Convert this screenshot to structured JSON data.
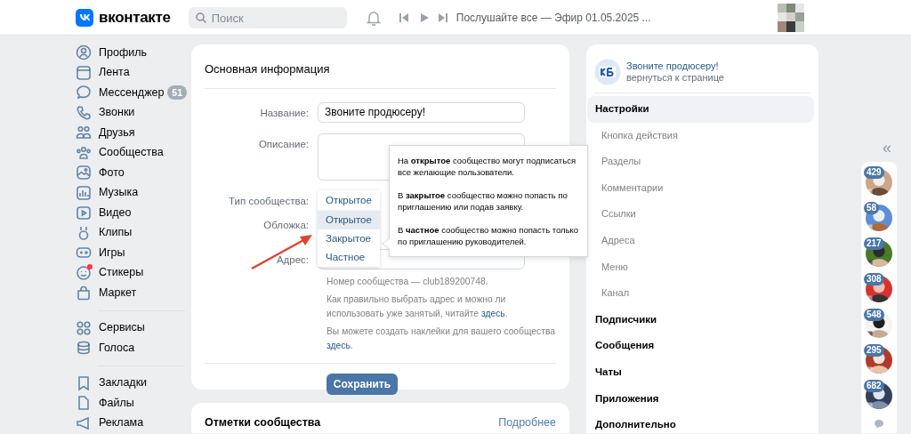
{
  "header": {
    "logo": "вконтакте",
    "search": {
      "placeholder": "Поиск"
    },
    "player_text": "Послушайте все — Эфир 01.05.2025 ..."
  },
  "nav": {
    "groups": [
      [
        {
          "label": "Профиль"
        },
        {
          "label": "Лента"
        },
        {
          "label": "Мессенджер",
          "badge": "51"
        },
        {
          "label": "Звонки"
        },
        {
          "label": "Друзья"
        },
        {
          "label": "Сообщества"
        },
        {
          "label": "Фото"
        },
        {
          "label": "Музыка"
        },
        {
          "label": "Видео"
        },
        {
          "label": "Клипы"
        },
        {
          "label": "Игры"
        },
        {
          "label": "Стикеры",
          "dot": true
        },
        {
          "label": "Маркет"
        }
      ],
      [
        {
          "label": "Сервисы"
        },
        {
          "label": "Голоса"
        }
      ],
      [
        {
          "label": "Закладки"
        },
        {
          "label": "Файлы"
        },
        {
          "label": "Реклама"
        }
      ]
    ]
  },
  "main_card": {
    "title": "Основная информация",
    "fields": [
      {
        "kind": "input",
        "label": "Название:",
        "value": "Звоните продюсеру!"
      },
      {
        "kind": "textarea",
        "label": "Описание:"
      },
      {
        "kind": "select",
        "label": "Тип сообщества:",
        "value": "Открытое"
      },
      {
        "kind": "cover",
        "label": "Обложка:"
      },
      {
        "kind": "input",
        "label": "Адрес:"
      }
    ],
    "hints": [
      "Номер сообщества — club189200748.",
      "Как правильно выбрать адрес и можно ли использовать уже занятый, читайте **здесь**.",
      "Вы можете создать наклейки для вашего сообщества **здесь**."
    ],
    "save_button": "Сохранить",
    "dropdown": [
      {
        "label": "Открытое",
        "selected": true
      },
      {
        "label": "Закрытое",
        "selected": false
      },
      {
        "label": "Частное",
        "selected": false
      }
    ],
    "tooltip": [
      "На **открытое** сообщество могут подписаться все желающие пользователи.",
      "В **закрытое** сообщество можно попасть по приглашению или подав заявку.",
      "В **частное** сообщество можно попасть только по приглашению руководителей."
    ]
  },
  "second_card": {
    "title": "Отметки сообщества",
    "link": "Подробнее"
  },
  "right_panel": {
    "group_name": "Звоните продюсеру!",
    "back_link": "вернуться к странице",
    "menu": [
      {
        "label": "Настройки",
        "selected": true,
        "children": [
          {
            "label": "Кнопка действия",
            "selected": false
          },
          {
            "label": "Разделы",
            "selected": false
          },
          {
            "label": "Комментарии",
            "selected": false
          },
          {
            "label": "Ссылки",
            "selected": false
          },
          {
            "label": "Адреса",
            "selected": false
          },
          {
            "label": "Меню",
            "selected": false
          },
          {
            "label": "Канал",
            "selected": false
          }
        ]
      },
      {
        "label": "Подписчики",
        "selected": false
      },
      {
        "label": "Сообщения",
        "selected": false
      },
      {
        "label": "Чаты",
        "selected": false
      },
      {
        "label": "Приложения",
        "selected": false
      },
      {
        "label": "Дополнительно",
        "selected": false
      }
    ]
  },
  "chats": {
    "collapse": "«",
    "items": [
      {
        "count": "429"
      },
      {
        "count": "58"
      },
      {
        "count": "217"
      },
      {
        "count": "308"
      },
      {
        "count": "548"
      },
      {
        "count": "295"
      },
      {
        "count": "682"
      }
    ]
  }
}
